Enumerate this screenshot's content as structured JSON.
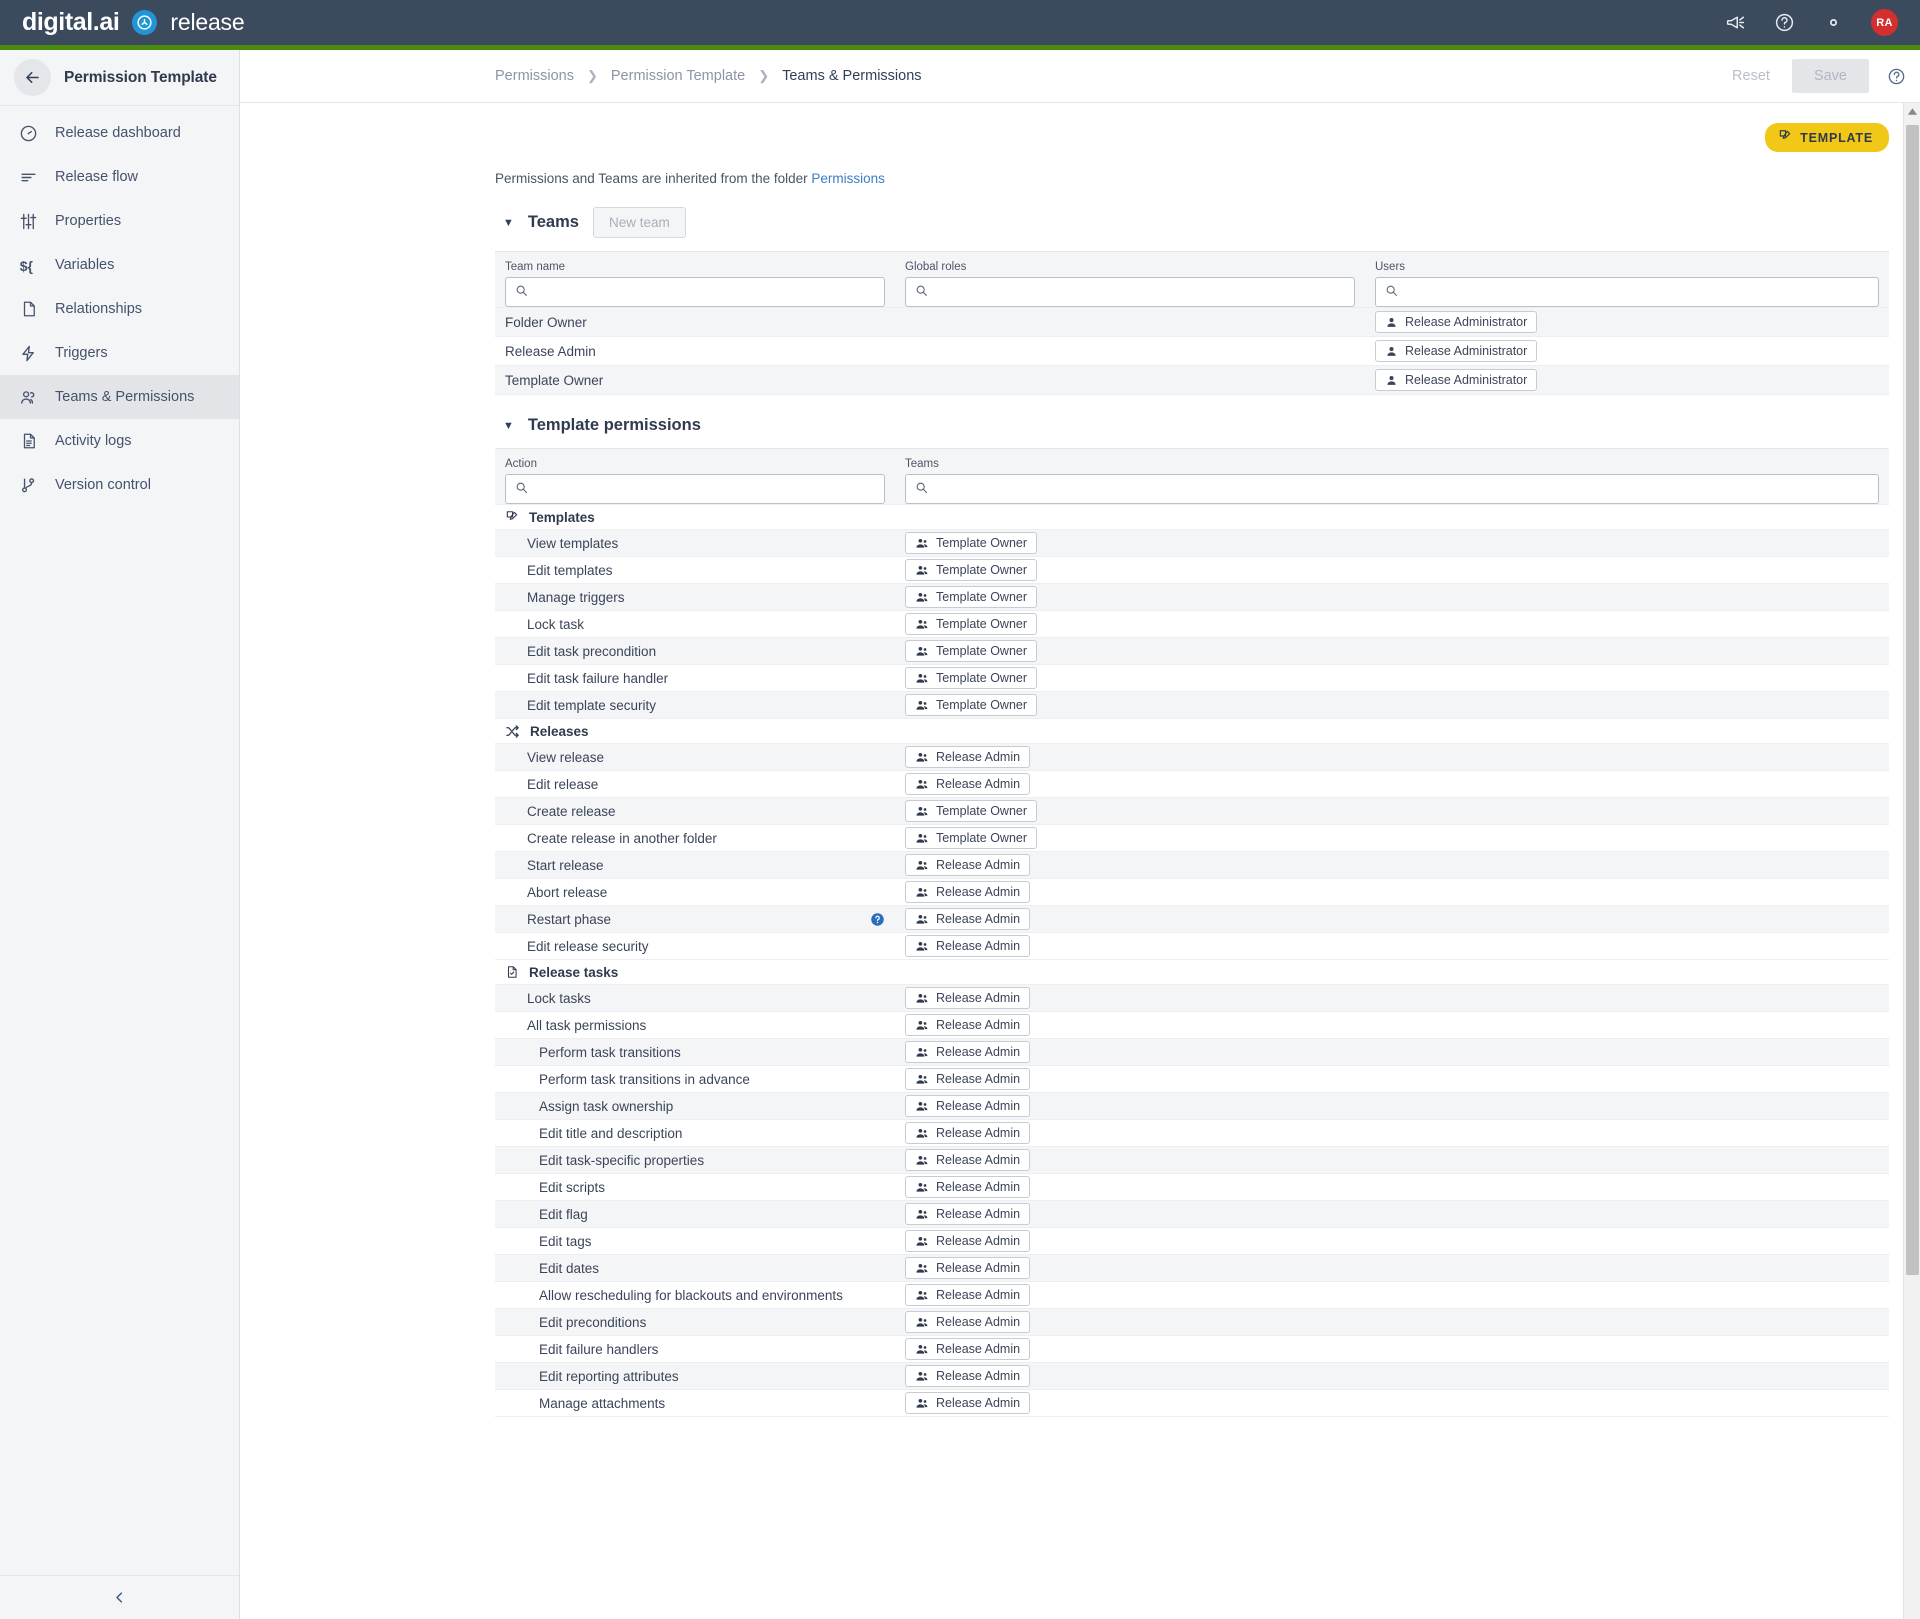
{
  "topbar": {
    "brand_primary": "digital.ai",
    "brand_secondary": "release",
    "icons": [
      "megaphone-icon",
      "help-icon",
      "gear-icon"
    ],
    "avatar_initials": "RA",
    "accent_green": "#4d8b10",
    "navy": "#3c4a5e"
  },
  "sidebar": {
    "title": "Permission Template",
    "back_icon": "arrow-left-icon",
    "collapse_icon": "chevron-left-icon",
    "items": [
      {
        "label": "Release dashboard",
        "icon": "gauge-icon",
        "active": false
      },
      {
        "label": "Release flow",
        "icon": "flow-lines-icon",
        "active": false
      },
      {
        "label": "Properties",
        "icon": "sliders-icon",
        "active": false
      },
      {
        "label": "Variables",
        "icon": "variable-icon",
        "active": false
      },
      {
        "label": "Relationships",
        "icon": "document-icon",
        "active": false
      },
      {
        "label": "Triggers",
        "icon": "bolt-icon",
        "active": false
      },
      {
        "label": "Teams & Permissions",
        "icon": "people-icon",
        "active": true
      },
      {
        "label": "Activity logs",
        "icon": "log-document-icon",
        "active": false
      },
      {
        "label": "Version control",
        "icon": "branch-icon",
        "active": false
      }
    ]
  },
  "breadcrumbs": [
    {
      "label": "Permissions",
      "current": false
    },
    {
      "label": "Permission Template",
      "current": false
    },
    {
      "label": "Teams & Permissions",
      "current": true
    }
  ],
  "actions": {
    "reset_label": "Reset",
    "save_label": "Save",
    "help_icon": "help-circle-icon"
  },
  "template_badge": {
    "label": "TEMPLATE",
    "icon": "template-icon",
    "color": "#f2c818"
  },
  "inherit_note": {
    "prefix": "Permissions and Teams are inherited from the folder ",
    "link": "Permissions"
  },
  "teams_section": {
    "title": "Teams",
    "new_team_label": "New team",
    "columns": [
      "Team name",
      "Global roles",
      "Users"
    ],
    "filters": {
      "team_name": "",
      "global_roles": "",
      "users": ""
    },
    "rows": [
      {
        "team_name": "Folder Owner",
        "global_roles": "",
        "users": [
          "Release Administrator"
        ]
      },
      {
        "team_name": "Release Admin",
        "global_roles": "",
        "users": [
          "Release Administrator"
        ]
      },
      {
        "team_name": "Template Owner",
        "global_roles": "",
        "users": [
          "Release Administrator"
        ]
      }
    ]
  },
  "permissions_section": {
    "title": "Template permissions",
    "columns": [
      "Action",
      "Teams"
    ],
    "filters": {
      "action": "",
      "teams": ""
    },
    "groups": [
      {
        "name": "Templates",
        "icon": "template-icon",
        "rows": [
          {
            "action": "View templates",
            "indent": 0,
            "teams": [
              "Template Owner"
            ]
          },
          {
            "action": "Edit templates",
            "indent": 0,
            "teams": [
              "Template Owner"
            ]
          },
          {
            "action": "Manage triggers",
            "indent": 0,
            "teams": [
              "Template Owner"
            ]
          },
          {
            "action": "Lock task",
            "indent": 0,
            "teams": [
              "Template Owner"
            ]
          },
          {
            "action": "Edit task precondition",
            "indent": 0,
            "teams": [
              "Template Owner"
            ]
          },
          {
            "action": "Edit task failure handler",
            "indent": 0,
            "teams": [
              "Template Owner"
            ]
          },
          {
            "action": "Edit template security",
            "indent": 0,
            "teams": [
              "Template Owner"
            ]
          }
        ]
      },
      {
        "name": "Releases",
        "icon": "shuffle-icon",
        "rows": [
          {
            "action": "View release",
            "indent": 0,
            "teams": [
              "Release Admin"
            ]
          },
          {
            "action": "Edit release",
            "indent": 0,
            "teams": [
              "Release Admin"
            ]
          },
          {
            "action": "Create release",
            "indent": 0,
            "teams": [
              "Template Owner"
            ]
          },
          {
            "action": "Create release in another folder",
            "indent": 0,
            "teams": [
              "Template Owner"
            ]
          },
          {
            "action": "Start release",
            "indent": 0,
            "teams": [
              "Release Admin"
            ]
          },
          {
            "action": "Abort release",
            "indent": 0,
            "teams": [
              "Release Admin"
            ]
          },
          {
            "action": "Restart phase",
            "indent": 0,
            "teams": [
              "Release Admin"
            ],
            "help": true
          },
          {
            "action": "Edit release security",
            "indent": 0,
            "teams": [
              "Release Admin"
            ]
          }
        ]
      },
      {
        "name": "Release tasks",
        "icon": "task-document-icon",
        "rows": [
          {
            "action": "Lock tasks",
            "indent": 0,
            "teams": [
              "Release Admin"
            ]
          },
          {
            "action": "All task permissions",
            "indent": 0,
            "teams": [
              "Release Admin"
            ]
          },
          {
            "action": "Perform task transitions",
            "indent": 1,
            "teams": [
              "Release Admin"
            ]
          },
          {
            "action": "Perform task transitions in advance",
            "indent": 1,
            "teams": [
              "Release Admin"
            ]
          },
          {
            "action": "Assign task ownership",
            "indent": 1,
            "teams": [
              "Release Admin"
            ]
          },
          {
            "action": "Edit title and description",
            "indent": 1,
            "teams": [
              "Release Admin"
            ]
          },
          {
            "action": "Edit task-specific properties",
            "indent": 1,
            "teams": [
              "Release Admin"
            ]
          },
          {
            "action": "Edit scripts",
            "indent": 1,
            "teams": [
              "Release Admin"
            ]
          },
          {
            "action": "Edit flag",
            "indent": 1,
            "teams": [
              "Release Admin"
            ]
          },
          {
            "action": "Edit tags",
            "indent": 1,
            "teams": [
              "Release Admin"
            ]
          },
          {
            "action": "Edit dates",
            "indent": 1,
            "teams": [
              "Release Admin"
            ]
          },
          {
            "action": "Allow rescheduling for blackouts and environments",
            "indent": 1,
            "teams": [
              "Release Admin"
            ]
          },
          {
            "action": "Edit preconditions",
            "indent": 1,
            "teams": [
              "Release Admin"
            ]
          },
          {
            "action": "Edit failure handlers",
            "indent": 1,
            "teams": [
              "Release Admin"
            ]
          },
          {
            "action": "Edit reporting attributes",
            "indent": 1,
            "teams": [
              "Release Admin"
            ]
          },
          {
            "action": "Manage attachments",
            "indent": 1,
            "teams": [
              "Release Admin"
            ]
          }
        ]
      }
    ]
  },
  "search_placeholder": ""
}
